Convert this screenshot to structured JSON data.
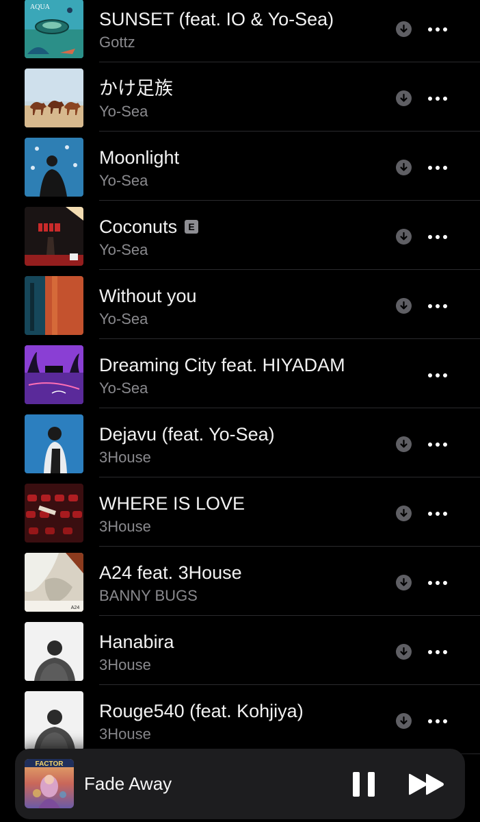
{
  "tracks": [
    {
      "title": "SUNSET (feat. IO & Yo-Sea)",
      "artist": "Gottz",
      "explicit": "",
      "downloadable": true,
      "art_text": "AQUA",
      "art": "aqua"
    },
    {
      "title": "かけ足族",
      "artist": "Yo-Sea",
      "explicit": "",
      "downloadable": true,
      "art_text": "",
      "art": "horses"
    },
    {
      "title": "Moonlight",
      "artist": "Yo-Sea",
      "explicit": "",
      "downloadable": true,
      "art_text": "",
      "art": "moonlight"
    },
    {
      "title": "Coconuts",
      "artist": "Yo-Sea",
      "explicit": "E",
      "downloadable": true,
      "art_text": "",
      "art": "coconuts"
    },
    {
      "title": "Without you",
      "artist": "Yo-Sea",
      "explicit": "",
      "downloadable": true,
      "art_text": "",
      "art": "withoutyou"
    },
    {
      "title": "Dreaming City feat. HIYADAM",
      "artist": "Yo-Sea",
      "explicit": "",
      "downloadable": false,
      "art_text": "",
      "art": "dreaming"
    },
    {
      "title": "Dejavu (feat. Yo-Sea)",
      "artist": "3House",
      "explicit": "",
      "downloadable": true,
      "art_text": "",
      "art": "dejavu"
    },
    {
      "title": "WHERE IS LOVE",
      "artist": "3House",
      "explicit": "",
      "downloadable": true,
      "art_text": "",
      "art": "theater"
    },
    {
      "title": "A24 feat. 3House",
      "artist": "BANNY BUGS",
      "explicit": "",
      "downloadable": true,
      "art_text": "A24",
      "art": "a24"
    },
    {
      "title": "Hanabira",
      "artist": "3House",
      "explicit": "",
      "downloadable": true,
      "art_text": "",
      "art": "portrait"
    },
    {
      "title": "Rouge540 (feat. Kohjiya)",
      "artist": "3House",
      "explicit": "",
      "downloadable": true,
      "art_text": "",
      "art": "portrait"
    }
  ],
  "mini_player": {
    "title": "Fade Away",
    "art_text": "FACTOR",
    "pause_icon": "pause-icon",
    "forward_icon": "forward-icon"
  },
  "icons": {
    "download": "arrow-down-circle-icon",
    "more": "ellipsis-icon"
  },
  "colors": {
    "background": "#000000",
    "title_text": "#f2f2f2",
    "secondary_text": "#8a8a8e",
    "divider": "#2b2b2e",
    "mini_player_bg": "#1d1d1f",
    "icon_gray": "#6e6e73",
    "explicit_badge": "#8e8e93"
  }
}
